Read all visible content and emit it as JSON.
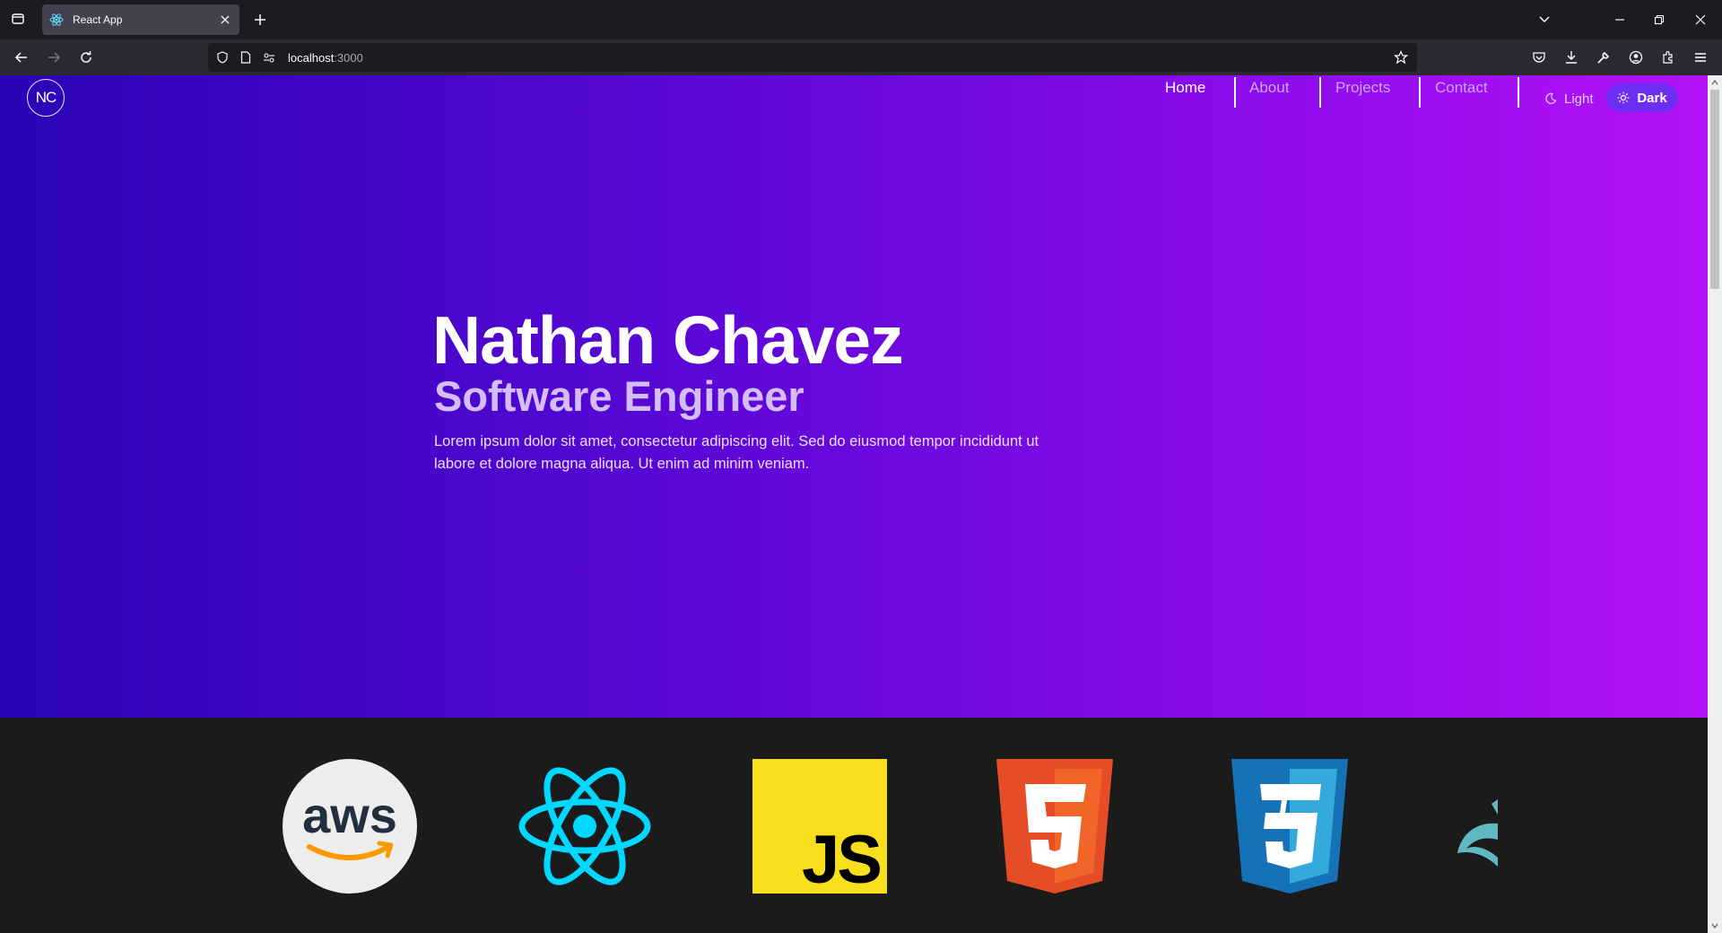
{
  "browser": {
    "tab_title": "React App",
    "url_host": "localhost",
    "url_port": ":3000"
  },
  "site": {
    "logo_text": "NC",
    "nav": [
      {
        "label": "Home",
        "active": true
      },
      {
        "label": "About",
        "active": false
      },
      {
        "label": "Projects",
        "active": false
      },
      {
        "label": "Contact",
        "active": false
      }
    ],
    "theme_light_label": "Light",
    "theme_dark_label": "Dark"
  },
  "hero": {
    "name": "Nathan Chavez",
    "role": "Software Engineer",
    "description": "Lorem ipsum dolor sit amet, consectetur adipiscing elit. Sed do eiusmod tempor incididunt ut labore et dolore magna aliqua. Ut enim ad minim veniam."
  },
  "skills": [
    {
      "name": "aws-logo"
    },
    {
      "name": "react-logo"
    },
    {
      "name": "javascript-logo",
      "text": "JS"
    },
    {
      "name": "html5-logo"
    },
    {
      "name": "css3-logo"
    },
    {
      "name": "partial-logo"
    }
  ],
  "colors": {
    "hero_gradient_start": "#2a04b5",
    "hero_gradient_end": "#b312f7",
    "skills_bg": "#1b1b1b",
    "dark_button": "#6d2ef2"
  }
}
